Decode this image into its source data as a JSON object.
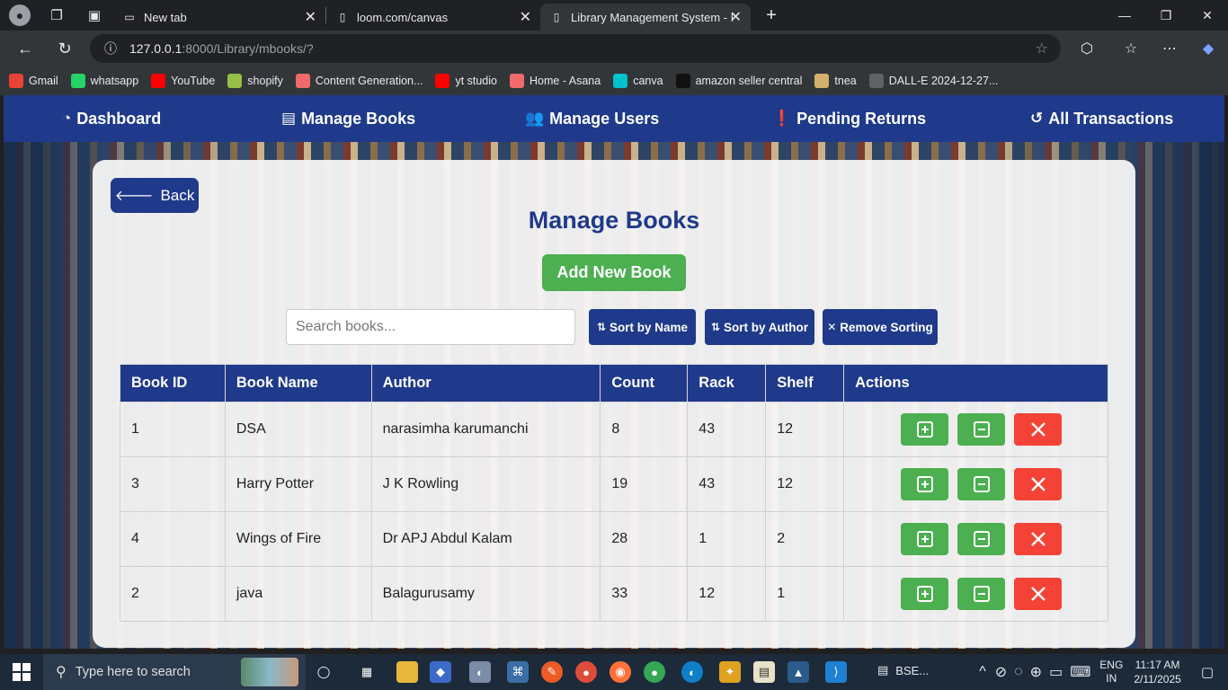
{
  "browser": {
    "tabs": [
      {
        "title": "New tab",
        "active": false
      },
      {
        "title": "loom.com/canvas",
        "active": false
      },
      {
        "title": "Library Management System - Ma",
        "active": true
      }
    ],
    "url_host": "127.0.0.1",
    "url_path": ":8000/Library/mbooks/?",
    "bookmarks": [
      {
        "label": "Gmail",
        "icon": "gmail-icon",
        "color": "#ea4335"
      },
      {
        "label": "whatsapp",
        "icon": "whatsapp-icon",
        "color": "#25d366"
      },
      {
        "label": "YouTube",
        "icon": "youtube-icon",
        "color": "#ff0000"
      },
      {
        "label": "shopify",
        "icon": "shopify-icon",
        "color": "#95bf47"
      },
      {
        "label": "Content Generation...",
        "icon": "asana-icon",
        "color": "#f06a6a"
      },
      {
        "label": "yt studio",
        "icon": "youtube-icon",
        "color": "#ff0000"
      },
      {
        "label": "Home - Asana",
        "icon": "asana-icon",
        "color": "#f06a6a"
      },
      {
        "label": "canva",
        "icon": "canva-icon",
        "color": "#00c4cc"
      },
      {
        "label": "amazon seller central",
        "icon": "amazon-icon",
        "color": "#111111"
      },
      {
        "label": "tnea",
        "icon": "tnea-icon",
        "color": "#d4b06a"
      },
      {
        "label": "DALL-E 2024-12-27...",
        "icon": "file-icon",
        "color": "#5f6368"
      }
    ]
  },
  "nav": {
    "dashboard": "Dashboard",
    "manage_books": "Manage Books",
    "manage_users": "Manage Users",
    "pending_returns": "Pending Returns",
    "all_transactions": "All Transactions"
  },
  "page": {
    "back_label": "Back",
    "title": "Manage Books",
    "add_label": "Add New Book",
    "search_placeholder": "Search books...",
    "sort_name_label": "Sort by Name",
    "sort_author_label": "Sort by Author",
    "remove_sort_label": "Remove Sorting"
  },
  "table": {
    "headers": [
      "Book ID",
      "Book Name",
      "Author",
      "Count",
      "Rack",
      "Shelf",
      "Actions"
    ],
    "rows": [
      [
        "1",
        "DSA",
        "narasimha karumanchi",
        "8",
        "43",
        "12"
      ],
      [
        "3",
        "Harry Potter",
        "J K Rowling",
        "19",
        "43",
        "12"
      ],
      [
        "4",
        "Wings of Fire",
        "Dr APJ Abdul Kalam",
        "28",
        "1",
        "2"
      ],
      [
        "2",
        "java",
        "Balagurusamy",
        "33",
        "12",
        "1"
      ]
    ]
  },
  "taskbar": {
    "search_placeholder": "Type here to search",
    "bse_label": "BSE...",
    "lang_top": "ENG",
    "lang_bottom": "IN",
    "time": "11:17 AM",
    "date": "2/11/2025"
  },
  "colors": {
    "primary": "#1f3a8a",
    "success": "#4caf50",
    "danger": "#f44336"
  }
}
